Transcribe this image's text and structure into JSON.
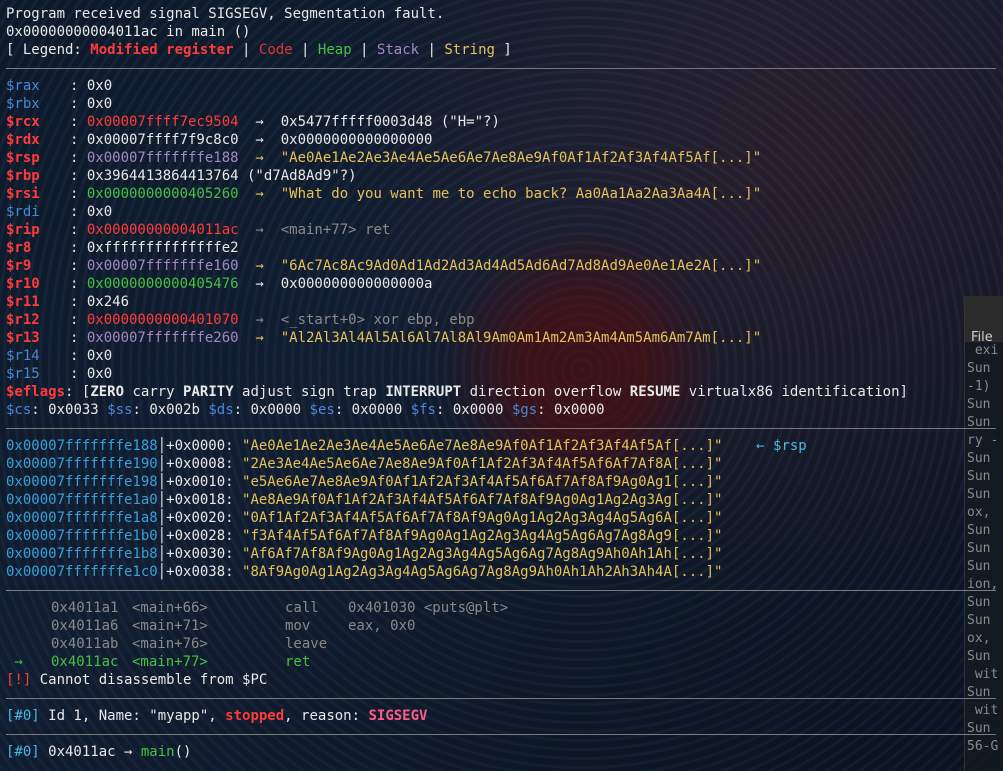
{
  "signal": {
    "line1": "Program received signal SIGSEGV, Segmentation fault.",
    "line2": "0x00000000004011ac in main ()"
  },
  "legend": {
    "open": "[ Legend: ",
    "modified": "Modified register",
    "code": "Code",
    "heap": "Heap",
    "stack": "Stack",
    "string": "String",
    "close": " ]"
  },
  "registers": [
    {
      "name": "$rax",
      "name_style": "blue",
      "value": "0x0",
      "value_style": "plain",
      "rest": "",
      "rest_style": "plain"
    },
    {
      "name": "$rbx",
      "name_style": "blue",
      "value": "0x0",
      "value_style": "plain",
      "rest": "",
      "rest_style": "plain"
    },
    {
      "name": "$rcx",
      "name_style": "red",
      "value": "0x00007ffff7ec9504",
      "value_style": "red",
      "rest": "  →  0x5477fffff0003d48 (\"H=\"?)",
      "rest_style": "plain"
    },
    {
      "name": "$rdx",
      "name_style": "red",
      "value": "0x00007ffff7f9c8c0",
      "value_style": "plain",
      "rest": "  →  0x0000000000000000",
      "rest_style": "plain"
    },
    {
      "name": "$rsp",
      "name_style": "red",
      "value": "0x00007fffffffe188",
      "value_style": "purple",
      "rest": "  →  \"Ae0Ae1Ae2Ae3Ae4Ae5Ae6Ae7Ae8Ae9Af0Af1Af2Af3Af4Af5Af[...]\"",
      "rest_style": "str"
    },
    {
      "name": "$rbp",
      "name_style": "red",
      "value": "0x3964413864413764",
      "value_style": "plain",
      "rest": " (\"d7Ad8Ad9\"?)",
      "rest_style": "plain"
    },
    {
      "name": "$rsi",
      "name_style": "red",
      "value": "0x0000000000405260",
      "value_style": "green",
      "rest": "  →  \"What do you want me to echo back? Aa0Aa1Aa2Aa3Aa4A[...]\"",
      "rest_style": "str"
    },
    {
      "name": "$rdi",
      "name_style": "blue",
      "value": "0x0",
      "value_style": "plain",
      "rest": "",
      "rest_style": "plain"
    },
    {
      "name": "$rip",
      "name_style": "red",
      "value": "0x00000000004011ac",
      "value_style": "red",
      "rest": "  →  <main+77> ret",
      "rest_style": "gray"
    },
    {
      "name": "$r8",
      "name_style": "red",
      "value": "0xffffffffffffffe2",
      "value_style": "plain",
      "rest": "",
      "rest_style": "plain"
    },
    {
      "name": "$r9",
      "name_style": "red",
      "value": "0x00007fffffffe160",
      "value_style": "purple",
      "rest": "  →  \"6Ac7Ac8Ac9Ad0Ad1Ad2Ad3Ad4Ad5Ad6Ad7Ad8Ad9Ae0Ae1Ae2A[...]\"",
      "rest_style": "str"
    },
    {
      "name": "$r10",
      "name_style": "red",
      "value": "0x0000000000405476",
      "value_style": "green",
      "rest": "  →  0x000000000000000a",
      "rest_style": "plain"
    },
    {
      "name": "$r11",
      "name_style": "red",
      "value": "0x246",
      "value_style": "plain",
      "rest": "",
      "rest_style": "plain"
    },
    {
      "name": "$r12",
      "name_style": "red",
      "value": "0x0000000000401070",
      "value_style": "red",
      "rest": "  →  <_start+0> xor ebp, ebp",
      "rest_style": "gray"
    },
    {
      "name": "$r13",
      "name_style": "red",
      "value": "0x00007fffffffe260",
      "value_style": "purple",
      "rest": "  →  \"Al2Al3Al4Al5Al6Al7Al8Al9Am0Am1Am2Am3Am4Am5Am6Am7Am[...]\"",
      "rest_style": "str"
    },
    {
      "name": "$r14",
      "name_style": "blue",
      "value": "0x0",
      "value_style": "plain",
      "rest": "",
      "rest_style": "plain"
    },
    {
      "name": "$r15",
      "name_style": "blue",
      "value": "0x0",
      "value_style": "plain",
      "rest": "",
      "rest_style": "plain"
    }
  ],
  "eflags": {
    "name": "$eflags",
    "parts": [
      {
        "t": "[",
        "b": false
      },
      {
        "t": "ZERO",
        "b": true
      },
      {
        "t": " carry ",
        "b": false
      },
      {
        "t": "PARITY",
        "b": true
      },
      {
        "t": " adjust sign trap ",
        "b": false
      },
      {
        "t": "INTERRUPT",
        "b": true
      },
      {
        "t": " direction overflow ",
        "b": false
      },
      {
        "t": "RESUME",
        "b": true
      },
      {
        "t": " virtualx86 identification]",
        "b": false
      }
    ]
  },
  "segments": [
    {
      "name": "$cs",
      "value": "0x0033"
    },
    {
      "name": "$ss",
      "value": "0x002b"
    },
    {
      "name": "$ds",
      "value": "0x0000"
    },
    {
      "name": "$es",
      "value": "0x0000"
    },
    {
      "name": "$fs",
      "value": "0x0000"
    },
    {
      "name": "$gs",
      "value": "0x0000"
    }
  ],
  "stack": [
    {
      "addr": "0x00007fffffffe188",
      "off": "+0x0000: ",
      "val": "\"Ae0Ae1Ae2Ae3Ae4Ae5Ae6Ae7Ae8Ae9Af0Af1Af2Af3Af4Af5Af[...]\"",
      "mark": "    ← $rsp"
    },
    {
      "addr": "0x00007fffffffe190",
      "off": "+0x0008: ",
      "val": "\"2Ae3Ae4Ae5Ae6Ae7Ae8Ae9Af0Af1Af2Af3Af4Af5Af6Af7Af8A[...]\"",
      "mark": ""
    },
    {
      "addr": "0x00007fffffffe198",
      "off": "+0x0010: ",
      "val": "\"e5Ae6Ae7Ae8Ae9Af0Af1Af2Af3Af4Af5Af6Af7Af8Af9Ag0Ag1[...]\"",
      "mark": ""
    },
    {
      "addr": "0x00007fffffffe1a0",
      "off": "+0x0018: ",
      "val": "\"Ae8Ae9Af0Af1Af2Af3Af4Af5Af6Af7Af8Af9Ag0Ag1Ag2Ag3Ag[...]\"",
      "mark": ""
    },
    {
      "addr": "0x00007fffffffe1a8",
      "off": "+0x0020: ",
      "val": "\"0Af1Af2Af3Af4Af5Af6Af7Af8Af9Ag0Ag1Ag2Ag3Ag4Ag5Ag6A[...]\"",
      "mark": ""
    },
    {
      "addr": "0x00007fffffffe1b0",
      "off": "+0x0028: ",
      "val": "\"f3Af4Af5Af6Af7Af8Af9Ag0Ag1Ag2Ag3Ag4Ag5Ag6Ag7Ag8Ag9[...]\"",
      "mark": ""
    },
    {
      "addr": "0x00007fffffffe1b8",
      "off": "+0x0030: ",
      "val": "\"Af6Af7Af8Af9Ag0Ag1Ag2Ag3Ag4Ag5Ag6Ag7Ag8Ag9Ah0Ah1Ah[...]\"",
      "mark": ""
    },
    {
      "addr": "0x00007fffffffe1c0",
      "off": "+0x0038: ",
      "val": "\"8Af9Ag0Ag1Ag2Ag3Ag4Ag5Ag6Ag7Ag8Ag9Ah0Ah1Ah2Ah3Ah4A[...]\"",
      "mark": ""
    }
  ],
  "disasm": [
    {
      "prefix": "    ",
      "addr": "0x4011a1",
      "sym": "<main+66>",
      "op": "call",
      "args": "0x401030 <puts@plt>",
      "current": false
    },
    {
      "prefix": "    ",
      "addr": "0x4011a6",
      "sym": "<main+71>",
      "op": "mov",
      "args": "eax, 0x0",
      "current": false
    },
    {
      "prefix": "    ",
      "addr": "0x4011ab",
      "sym": "<main+76>",
      "op": "leave",
      "args": "",
      "current": false
    },
    {
      "prefix": " →  ",
      "addr": "0x4011ac",
      "sym": "<main+77>",
      "op": "ret",
      "args": "",
      "current": true
    }
  ],
  "disasm_error": {
    "tag": "[!]",
    "text": " Cannot disassemble from $PC"
  },
  "thread": {
    "tag": "[#0]",
    "pre": " Id 1, Name: \"myapp\", ",
    "state": "stopped",
    "mid": ", reason: ",
    "reason": "SIGSEGV"
  },
  "trace": {
    "tag": "[#0]",
    "pre": " 0x4011ac → ",
    "func": "main",
    "post": "()"
  },
  "side_panel": {
    "tab_label": "File",
    "lines": [
      " exi",
      "Sun",
      "-1)",
      "Sun",
      "Sun",
      "ry -",
      "Sun",
      "Sun",
      "Sun",
      "ox,",
      "Sun",
      "Sun",
      "Sun",
      "ion,",
      "Sun",
      "Sun",
      "ox,",
      "Sun",
      " wit",
      "Sun",
      " wit",
      "Sun",
      "56-G"
    ]
  }
}
